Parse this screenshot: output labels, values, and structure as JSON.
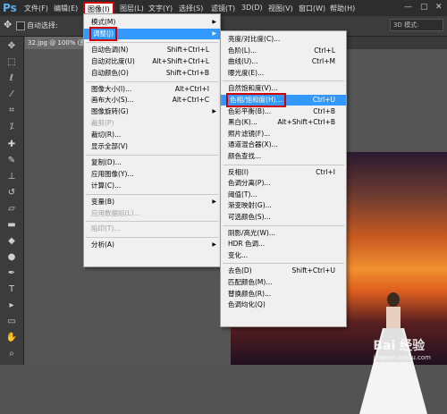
{
  "menubar": {
    "logo": "Ps",
    "items": [
      "文件(F)",
      "编辑(E)",
      "图像(I)",
      "图层(L)",
      "文字(Y)",
      "选择(S)",
      "滤镜(T)",
      "3D(D)",
      "视图(V)",
      "窗口(W)",
      "帮助(H)"
    ],
    "active": "图像(I)"
  },
  "optbar": {
    "auto_select": "自动选择:",
    "mode3d": "3D 模式:"
  },
  "doc_tab": "32.jpg @ 100% (图层",
  "image_menu": {
    "items": [
      {
        "label": "模式(M)",
        "sc": "",
        "sub": true,
        "disabled": false
      },
      {
        "label": "调整(J)",
        "sc": "",
        "sub": true,
        "disabled": false,
        "hl": true
      },
      {
        "label": "自动色调(N)",
        "sc": "Shift+Ctrl+L"
      },
      {
        "label": "自动对比度(U)",
        "sc": "Alt+Shift+Ctrl+L"
      },
      {
        "label": "自动颜色(O)",
        "sc": "Shift+Ctrl+B"
      },
      {
        "label": "图像大小(I)...",
        "sc": "Alt+Ctrl+I"
      },
      {
        "label": "画布大小(S)...",
        "sc": "Alt+Ctrl+C"
      },
      {
        "label": "图像旋转(G)",
        "sc": "",
        "sub": true
      },
      {
        "label": "裁剪(P)",
        "sc": "",
        "disabled": true
      },
      {
        "label": "裁切(R)...",
        "sc": ""
      },
      {
        "label": "显示全部(V)",
        "sc": ""
      },
      {
        "label": "复制(D)...",
        "sc": ""
      },
      {
        "label": "应用图像(Y)...",
        "sc": ""
      },
      {
        "label": "计算(C)...",
        "sc": ""
      },
      {
        "label": "变量(B)",
        "sc": "",
        "sub": true
      },
      {
        "label": "应用数据组(L)...",
        "sc": "",
        "disabled": true
      },
      {
        "label": "陷印(T)...",
        "sc": "",
        "disabled": true
      },
      {
        "label": "分析(A)",
        "sc": "",
        "sub": true
      }
    ]
  },
  "adjust_menu": {
    "items": [
      {
        "label": "亮度/对比度(C)...",
        "sc": ""
      },
      {
        "label": "色阶(L)...",
        "sc": "Ctrl+L"
      },
      {
        "label": "曲线(U)...",
        "sc": "Ctrl+M"
      },
      {
        "label": "曝光度(E)...",
        "sc": ""
      },
      {
        "label": "自然饱和度(V)...",
        "sc": ""
      },
      {
        "label": "色相/饱和度(H)...",
        "sc": "Ctrl+U",
        "hl": true
      },
      {
        "label": "色彩平衡(B)...",
        "sc": "Ctrl+B"
      },
      {
        "label": "黑白(K)...",
        "sc": "Alt+Shift+Ctrl+B"
      },
      {
        "label": "照片滤镜(F)...",
        "sc": ""
      },
      {
        "label": "通道混合器(X)...",
        "sc": ""
      },
      {
        "label": "颜色查找...",
        "sc": ""
      },
      {
        "label": "反相(I)",
        "sc": "Ctrl+I"
      },
      {
        "label": "色调分离(P)...",
        "sc": ""
      },
      {
        "label": "阈值(T)...",
        "sc": ""
      },
      {
        "label": "渐变映射(G)...",
        "sc": ""
      },
      {
        "label": "可选颜色(S)...",
        "sc": ""
      },
      {
        "label": "阴影/高光(W)...",
        "sc": ""
      },
      {
        "label": "HDR 色调...",
        "sc": ""
      },
      {
        "label": "变化...",
        "sc": ""
      },
      {
        "label": "去色(D)",
        "sc": "Shift+Ctrl+U"
      },
      {
        "label": "匹配颜色(M)...",
        "sc": ""
      },
      {
        "label": "替换颜色(R)...",
        "sc": ""
      },
      {
        "label": "色调均化(Q)",
        "sc": ""
      }
    ]
  },
  "watermark": {
    "brand": "Bai 经验",
    "url": "jingyan.baidu.com"
  }
}
